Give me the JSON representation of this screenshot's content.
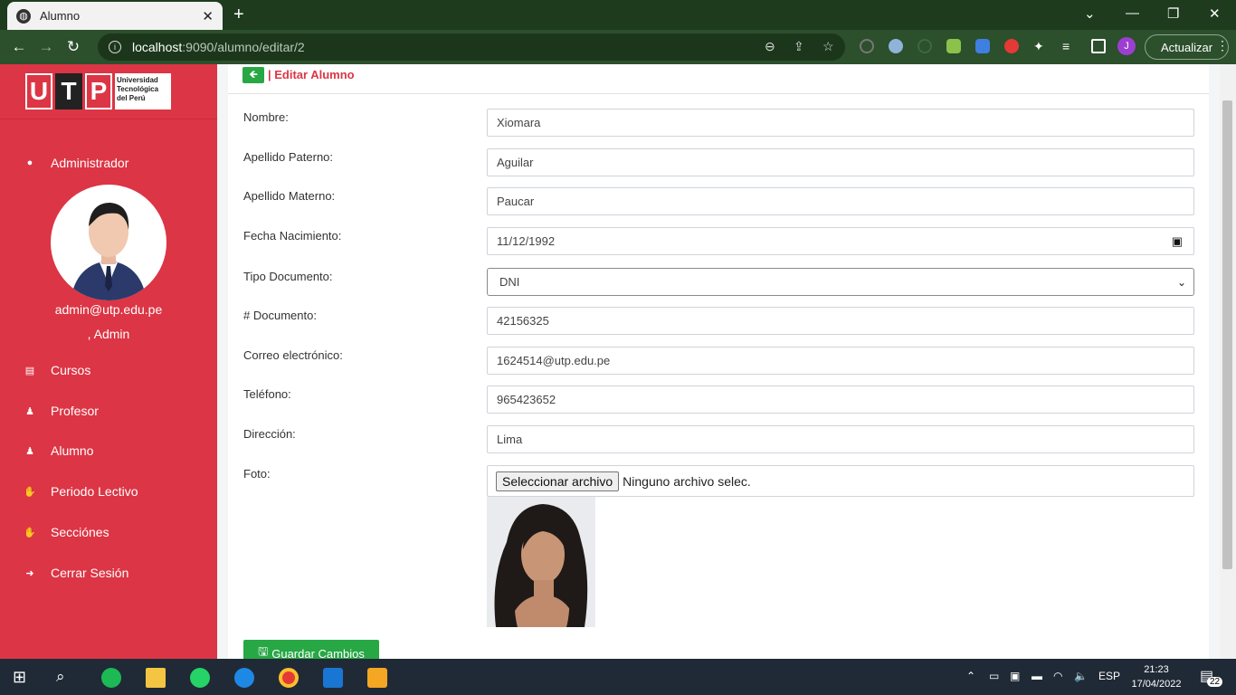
{
  "browser": {
    "tab_title": "Alumno",
    "url_host": "localhost",
    "url_path": ":9090/alumno/editar/2",
    "update_label": "Actualizar",
    "profile_initial": "J"
  },
  "sidebar": {
    "logo_letters": [
      "U",
      "T",
      "P"
    ],
    "logo_text": "Universidad Tecnológica del Perú",
    "admin_label": "Administrador",
    "email": "admin@utp.edu.pe",
    "role": ", Admin",
    "items": [
      {
        "label": "Cursos",
        "icon": "book-icon"
      },
      {
        "label": "Profesor",
        "icon": "teacher-icon"
      },
      {
        "label": "Alumno",
        "icon": "student-icon"
      },
      {
        "label": "Periodo Lectivo",
        "icon": "hand-icon"
      },
      {
        "label": "Secciónes",
        "icon": "hand-icon"
      },
      {
        "label": "Cerrar Sesión",
        "icon": "logout-icon"
      }
    ]
  },
  "form": {
    "title": "| Editar Alumno",
    "fields": {
      "nombre": {
        "label": "Nombre:",
        "value": "Xiomara"
      },
      "apellido_paterno": {
        "label": "Apellido Paterno:",
        "value": "Aguilar"
      },
      "apellido_materno": {
        "label": "Apellido Materno:",
        "value": "Paucar"
      },
      "fecha_nacimiento": {
        "label": "Fecha Nacimiento:",
        "value": "11/12/1992"
      },
      "tipo_documento": {
        "label": "Tipo Documento:",
        "value": "DNI"
      },
      "documento": {
        "label": "# Documento:",
        "value": "42156325"
      },
      "correo": {
        "label": "Correo electrónico:",
        "value": "1624514@utp.edu.pe"
      },
      "telefono": {
        "label": "Teléfono:",
        "value": "965423652"
      },
      "direccion": {
        "label": "Dirección:",
        "value": "Lima"
      },
      "foto": {
        "label": "Foto:",
        "button": "Seleccionar archivo",
        "status": "Ninguno archivo selec."
      }
    },
    "save_label": "Guardar Cambios"
  },
  "taskbar": {
    "lang": "ESP",
    "time": "21:23",
    "date": "17/04/2022",
    "notifications": "22"
  }
}
